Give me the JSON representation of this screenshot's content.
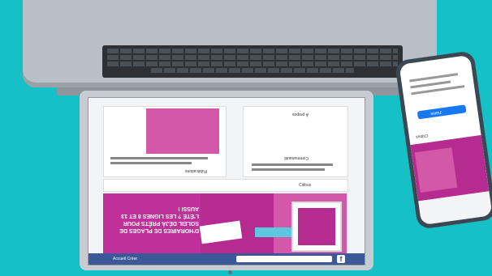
{
  "laptop": {
    "facebook": {
      "search_placeholder": "",
      "top_right": "Accueil  Créer",
      "cover_text": "D'HORAIRES DE PLAGES DE SOLEIL DÉJÀ PRÊTS POUR L'ÉTÉ ? LES LIGNES 8 ET 13 AUSSI !",
      "post_title": "Publications",
      "community_title": "Communauté",
      "about_title": "À propos",
      "brand": "Citibus"
    }
  },
  "phone": {
    "brand": "Citibus",
    "button": "J'aime"
  }
}
